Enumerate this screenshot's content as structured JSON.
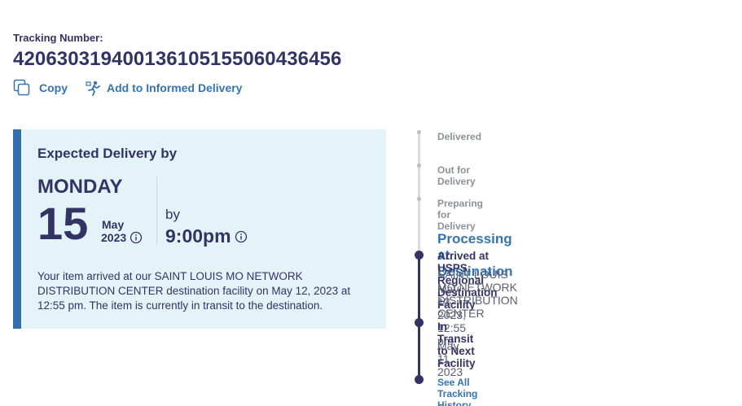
{
  "tracking": {
    "label": "Tracking Number:",
    "number": "420630319400136105155060436456"
  },
  "actions": {
    "copy_label": "Copy",
    "informed_label": "Add to Informed Delivery"
  },
  "expected": {
    "title": "Expected Delivery by",
    "day": "MONDAY",
    "date": "15",
    "month": "May",
    "year": "2023",
    "by_label": "by",
    "time": "9:00pm",
    "description": "Your item arrived at our SAINT LOUIS MO NETWORK DISTRIBUTION CENTER destination facility on May 12, 2023 at 12:55 pm. The item is currently in transit to the destination."
  },
  "timeline": {
    "upcoming": [
      "Delivered",
      "Out for Delivery",
      "Preparing for Delivery"
    ],
    "current_status": "Processing at Destination",
    "events": [
      {
        "title": "Arrived at USPS Regional Destination Facility",
        "location": "SAINT LOUIS MO NETWORK DISTRIBUTION CENTER",
        "datetime": "May 12, 2023, 12:55 pm"
      },
      {
        "title": "In Transit to Next Facility",
        "datetime": "May 11, 2023"
      }
    ],
    "see_all_label": "See All Tracking History"
  },
  "colors": {
    "navy": "#333366",
    "link_blue": "#3573b1",
    "box_bg": "#e3f3f8",
    "box_accent": "#336fa9"
  },
  "icons": [
    "copy-icon",
    "informed-delivery-icon",
    "info-icon"
  ]
}
